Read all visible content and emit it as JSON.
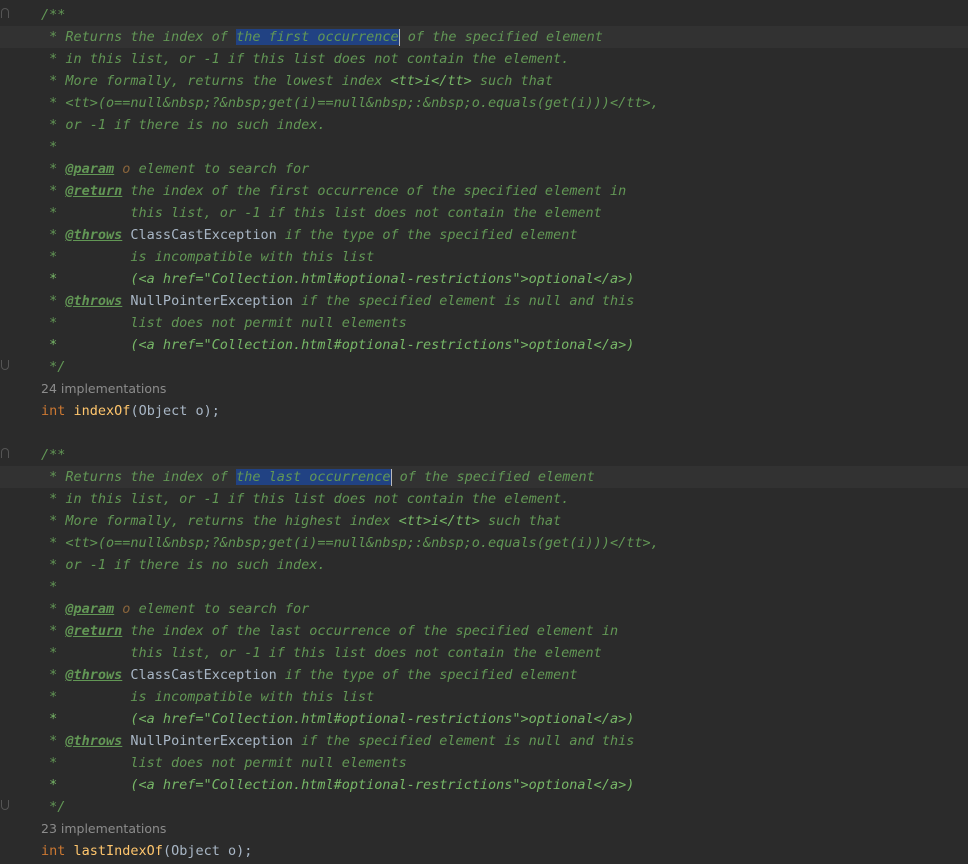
{
  "editor": {
    "block1": {
      "open": "/**",
      "returns_pre": " * Returns the index of ",
      "returns_sel": "the first occurrence",
      "returns_post": " of the specified element",
      "l2": " * in this list, or -1 if this list does not contain the element.",
      "l3_pre": " * More formally, returns the lowest index ",
      "l3_tt": "<tt>i</tt>",
      "l3_post": " such that",
      "l4": " * <tt>(o==null&nbsp;?&nbsp;get(i)==null&nbsp;:&nbsp;o.equals(get(i)))</tt>,",
      "l5": " * or -1 if there is no such index.",
      "l6": " *",
      "param_star": " * ",
      "param_tag": "@param",
      "param_name": " o",
      "param_desc": " element to search for",
      "return_tag": "@return",
      "return_desc": " the index of the first occurrence of the specified element in",
      "return_cont": " *         this list, or -1 if this list does not contain the element",
      "throws1_tag": "@throws",
      "throws1_cls": " ClassCastException",
      "throws1_desc": " if the type of the specified element",
      "throws1_c1": " *         is incompatible with this list",
      "throws1_c2": " *         (<a href=\"Collection.html#optional-restrictions\">optional</a>)",
      "throws2_tag": "@throws",
      "throws2_cls": " NullPointerException",
      "throws2_desc": " if the specified element is null and this",
      "throws2_c1": " *         list does not permit null elements",
      "throws2_c2": " *         (<a href=\"Collection.html#optional-restrictions\">optional</a>)",
      "close": " */",
      "impl_hint": "24 implementations",
      "sig_kw": "int",
      "sig_fn": "indexOf",
      "sig_rest": "(Object o);"
    },
    "block2": {
      "open": "/**",
      "returns_pre": " * Returns the index of ",
      "returns_sel": "the last occurrence",
      "returns_post": " of the specified element",
      "l2": " * in this list, or -1 if this list does not contain the element.",
      "l3_pre": " * More formally, returns the highest index ",
      "l3_tt": "<tt>i</tt>",
      "l3_post": " such that",
      "l4": " * <tt>(o==null&nbsp;?&nbsp;get(i)==null&nbsp;:&nbsp;o.equals(get(i)))</tt>,",
      "l5": " * or -1 if there is no such index.",
      "l6": " *",
      "param_star": " * ",
      "param_tag": "@param",
      "param_name": " o",
      "param_desc": " element to search for",
      "return_tag": "@return",
      "return_desc": " the index of the last occurrence of the specified element in",
      "return_cont": " *         this list, or -1 if this list does not contain the element",
      "throws1_tag": "@throws",
      "throws1_cls": " ClassCastException",
      "throws1_desc": " if the type of the specified element",
      "throws1_c1": " *         is incompatible with this list",
      "throws1_c2": " *         (<a href=\"Collection.html#optional-restrictions\">optional</a>)",
      "throws2_tag": "@throws",
      "throws2_cls": " NullPointerException",
      "throws2_desc": " if the specified element is null and this",
      "throws2_c1": " *         list does not permit null elements",
      "throws2_c2": " *         (<a href=\"Collection.html#optional-restrictions\">optional</a>)",
      "close": " */",
      "impl_hint": "23 implementations",
      "sig_kw": "int",
      "sig_fn": "lastIndexOf",
      "sig_rest": "(Object o);"
    }
  },
  "colors": {
    "background": "#2b2b2b",
    "doc_comment": "#629755",
    "keyword": "#cc7832",
    "method": "#ffc66d",
    "plain": "#a9b7c6",
    "selection": "#214283",
    "hint": "#8c8c8c"
  }
}
